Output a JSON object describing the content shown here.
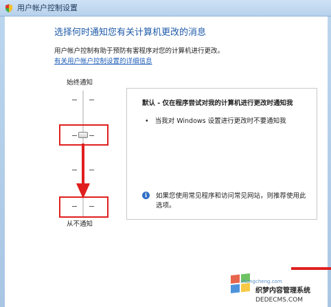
{
  "window": {
    "title": "用户帐户控制设置"
  },
  "main": {
    "heading": "选择何时通知您有关计算机更改的消息",
    "description": "用户帐户控制有助于预防有害程序对您的计算机进行更改。",
    "link": "有关用户帐户控制设置的详细信息"
  },
  "slider": {
    "top_label": "始终通知",
    "bottom_label": "从不通知",
    "level": 2,
    "levels": 4
  },
  "info_box": {
    "title": "默认 - 仅在程序尝试对我的计算机进行更改时通知我",
    "bullet": "当我对 Windows 设置进行更改时不要通知我",
    "note": "如果您使用常见程序和访问常见网站，则推荐使用此选项。"
  },
  "watermark": {
    "brand": "织梦内容管理系统",
    "site": "DEDECMS.COM",
    "url": "xitongcheng.com"
  },
  "colors": {
    "highlight": "#e01e1e",
    "heading": "#1e5aa8",
    "link": "#1d5cb8"
  }
}
